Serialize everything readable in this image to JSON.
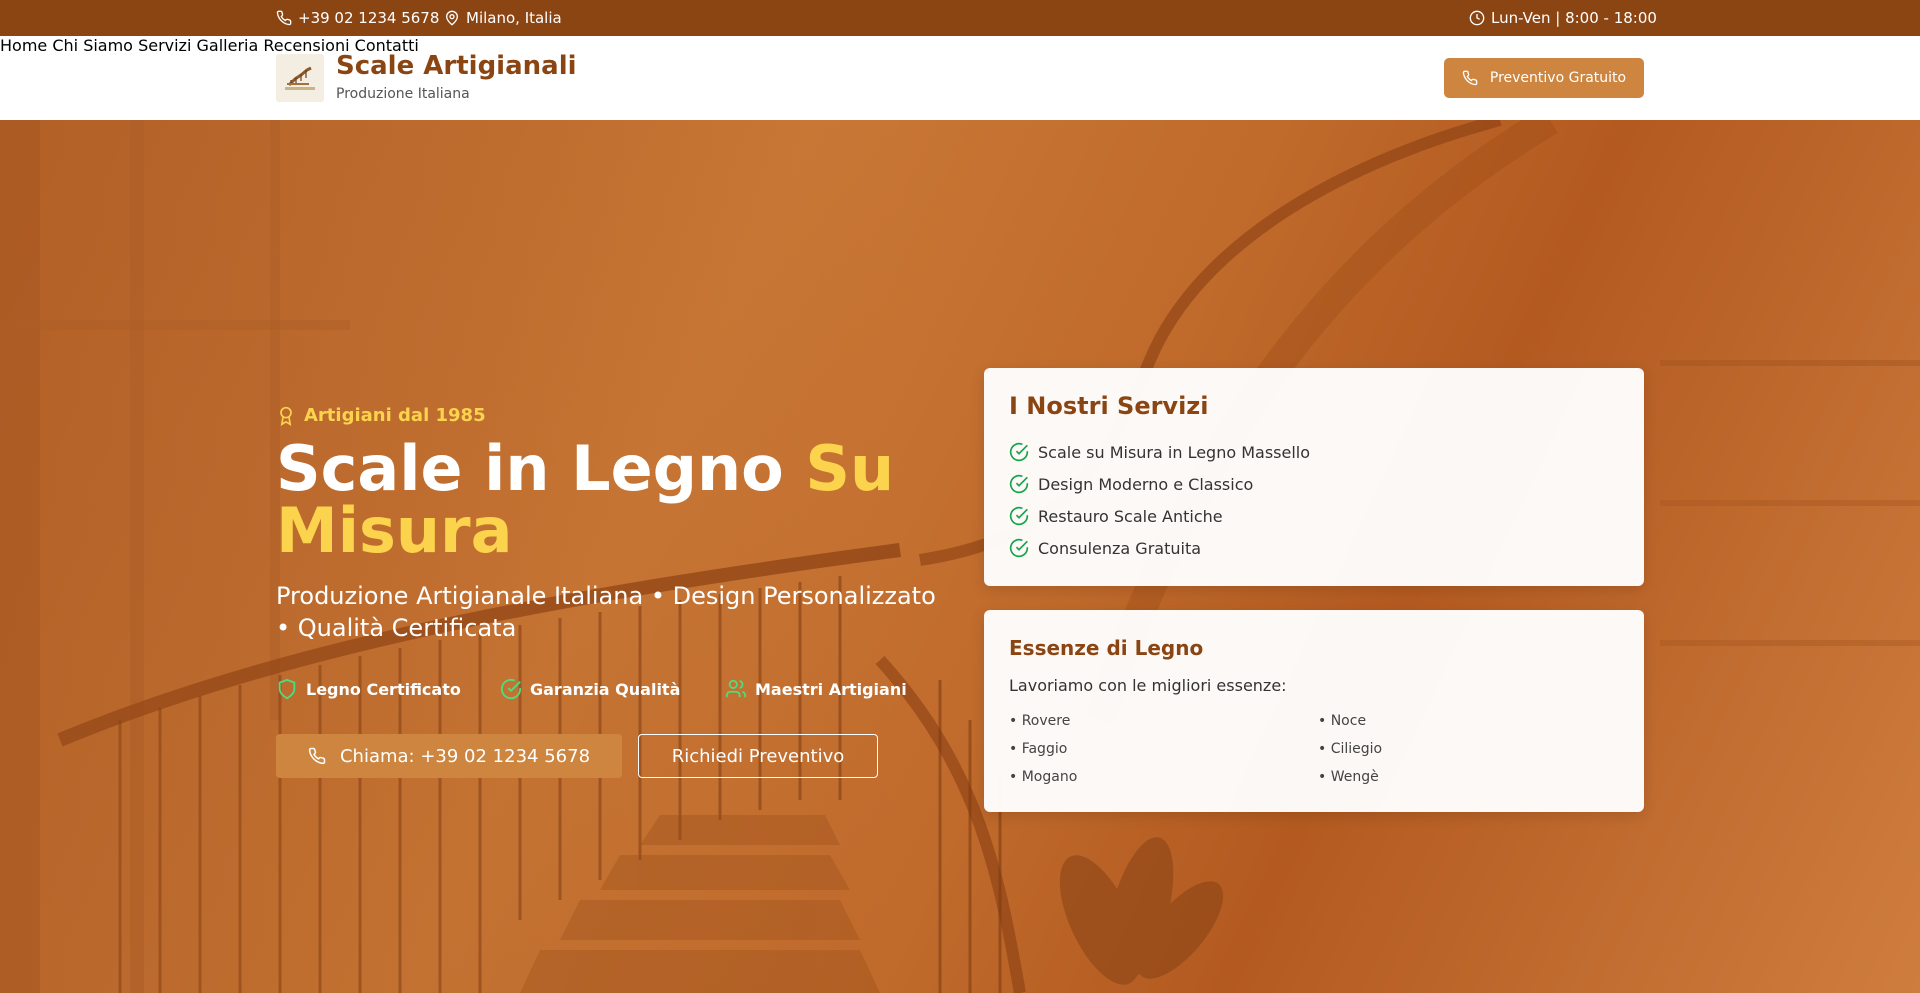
{
  "topbar": {
    "phone": "+39 02 1234 5678",
    "location": "Milano, Italia",
    "hours": "Lun-Ven | 8:00 - 18:00"
  },
  "header": {
    "brand_title": "Scale Artigianali",
    "brand_subtitle": "Produzione Italiana",
    "nav": [
      "Home",
      "Chi Siamo",
      "Servizi",
      "Galleria",
      "Recensioni",
      "Contatti"
    ],
    "cta_label": "Preventivo Gratuito"
  },
  "hero": {
    "badge": "Artigiani dal 1985",
    "title_main": "Scale in Legno ",
    "title_accent": "Su Misura",
    "subtitle": "Produzione Artigianale Italiana • Design Personalizzato • Qualità Certificata",
    "features": [
      "Legno Certificato",
      "Garanzia Qualità",
      "Maestri Artigiani"
    ],
    "call_button": "Chiama: +39 02 1234 5678",
    "quote_button": "Richiedi Preventivo"
  },
  "services_card": {
    "title": "I Nostri Servizi",
    "items": [
      "Scale su Misura in Legno Massello",
      "Design Moderno e Classico",
      "Restauro Scale Antiche",
      "Consulenza Gratuita"
    ]
  },
  "woods_card": {
    "title": "Essenze di Legno",
    "intro": "Lavoriamo con le migliori essenze:",
    "woods": [
      "• Rovere",
      "• Noce",
      "• Faggio",
      "• Ciliegio",
      "• Mogano",
      "• Wengè"
    ]
  },
  "colors": {
    "brand": "#8b4513",
    "accent": "#cd853f",
    "highlight": "#fcd34d",
    "check": "#16a34a"
  }
}
